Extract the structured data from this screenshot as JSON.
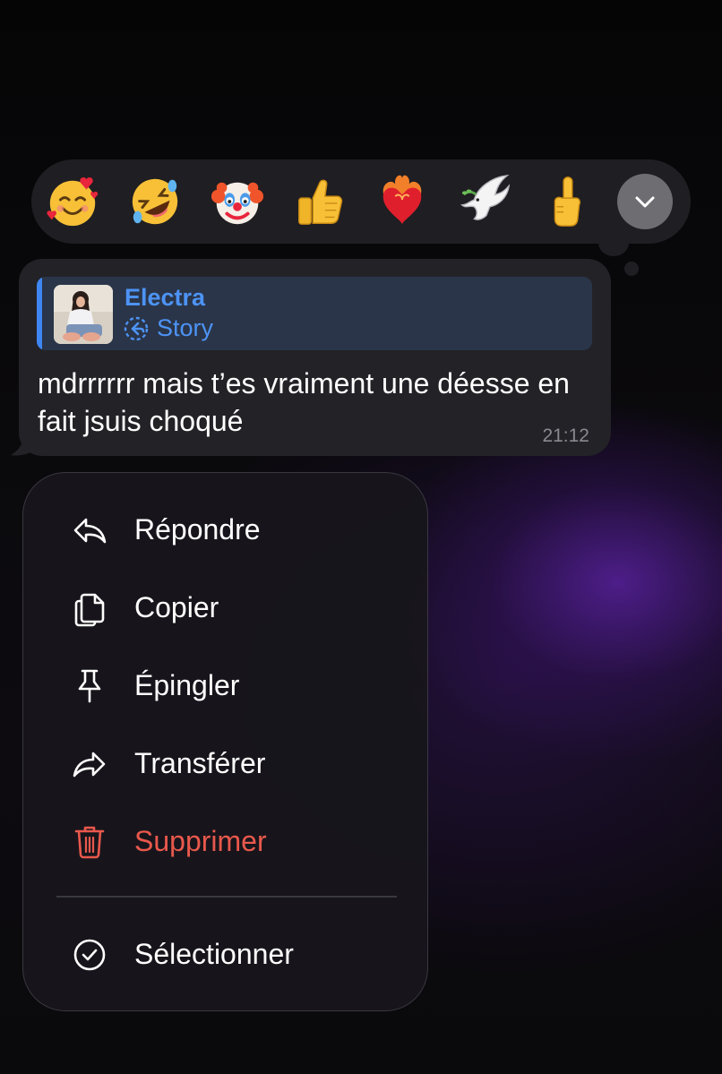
{
  "reactions": {
    "items": [
      {
        "name": "smiling-face-with-hearts"
      },
      {
        "name": "rolling-on-floor-laughing"
      },
      {
        "name": "clown-face"
      },
      {
        "name": "thumbs-up"
      },
      {
        "name": "heart-on-fire"
      },
      {
        "name": "dove"
      },
      {
        "name": "middle-finger"
      }
    ],
    "expand_icon": "chevron-down-icon"
  },
  "message": {
    "reply": {
      "name": "Electra",
      "subtitle": "Story",
      "subtitle_icon": "story-reply-icon"
    },
    "text": "mdrrrrrr mais t’es vraiment une déesse en fait jsuis choqué",
    "time": "21:12"
  },
  "menu": {
    "items": [
      {
        "label": "Répondre",
        "icon": "reply-icon"
      },
      {
        "label": "Copier",
        "icon": "copy-icon"
      },
      {
        "label": "Épingler",
        "icon": "pin-icon"
      },
      {
        "label": "Transférer",
        "icon": "forward-icon"
      },
      {
        "label": "Supprimer",
        "icon": "trash-icon",
        "color": "#e9584c"
      }
    ],
    "select_item": {
      "label": "Sélectionner",
      "icon": "checkmark-circle-icon"
    }
  },
  "colors": {
    "accent": "#3e86f2",
    "link": "#4d93f5",
    "danger": "#e9584c",
    "bubble": "#232227",
    "menu": "#18161c"
  }
}
